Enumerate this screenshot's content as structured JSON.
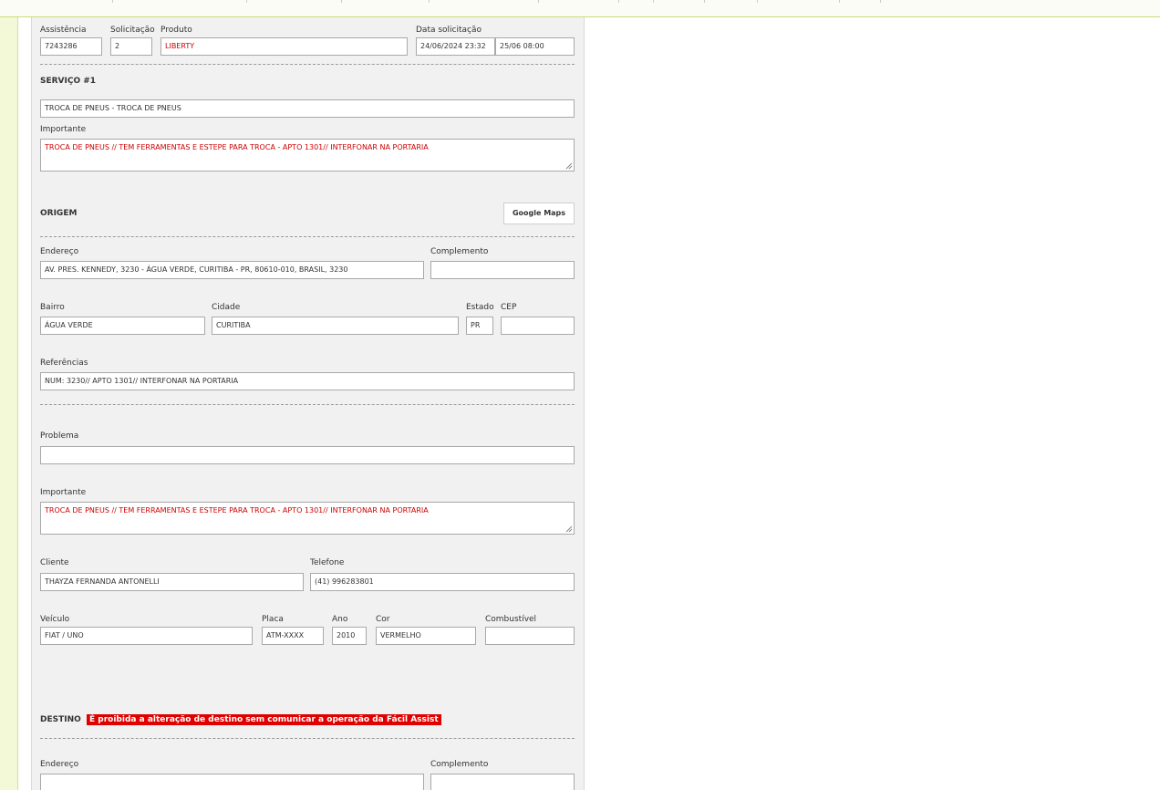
{
  "header": {
    "assistencia_label": "Assistência",
    "assistencia_value": "7243286",
    "solicitacao_label": "Solicitação",
    "solicitacao_value": "2",
    "produto_label": "Produto",
    "produto_value": "LIBERTY",
    "data_label": "Data solicitação",
    "data_value": "24/06/2024 23:32",
    "data_value2": "25/06 08:00"
  },
  "servico": {
    "title": "SERVIÇO #1",
    "value": "TROCA DE PNEUS - TROCA DE PNEUS",
    "importante_label": "Importante",
    "importante_value": "TROCA DE PNEUS // TEM FERRAMENTAS E ESTEPE PARA TROCA -  APTO 1301// INTERFONAR NA PORTARIA"
  },
  "origem": {
    "title": "ORIGEM",
    "maps_button": "Google Maps",
    "endereco_label": "Endereço",
    "endereco_value": "AV. PRES. KENNEDY, 3230 - ÁGUA VERDE, CURITIBA - PR, 80610-010, BRASIL, 3230",
    "complemento_label": "Complemento",
    "complemento_value": "",
    "bairro_label": "Bairro",
    "bairro_value": "ÁGUA VERDE",
    "cidade_label": "Cidade",
    "cidade_value": "CURITIBA",
    "estado_label": "Estado",
    "estado_value": "PR",
    "cep_label": "CEP",
    "cep_value": "",
    "referencias_label": "Referências",
    "referencias_value": "NUM: 3230// APTO 1301// INTERFONAR NA PORTARIA"
  },
  "problema": {
    "problema_label": "Problema",
    "problema_value": "",
    "importante_label": "Importante",
    "importante_value": "TROCA DE PNEUS // TEM FERRAMENTAS E ESTEPE PARA TROCA -  APTO 1301// INTERFONAR NA PORTARIA",
    "cliente_label": "Cliente",
    "cliente_value": "THAYZA FERNANDA ANTONELLI",
    "telefone_label": "Telefone",
    "telefone_value": "(41) 996283801",
    "veiculo_label": "Veículo",
    "veiculo_value": "FIAT / UNO",
    "placa_label": "Placa",
    "placa_value": "ATM-XXXX",
    "ano_label": "Ano",
    "ano_value": "2010",
    "cor_label": "Cor",
    "cor_value": "VERMELHO",
    "combustivel_label": "Combustível",
    "combustivel_value": ""
  },
  "destino": {
    "title": "DESTINO",
    "warning": "É proibida a alteração de destino sem comunicar a operação da Fácil Assist",
    "endereco_label": "Endereço",
    "endereco_value": "",
    "complemento_label": "Complemento",
    "complemento_value": ""
  },
  "colors": {
    "alert_bg": "#e00000",
    "highlight_text": "#cc0000",
    "panel_bg": "#f1f1f1",
    "side_bg": "#f3f8d6"
  }
}
